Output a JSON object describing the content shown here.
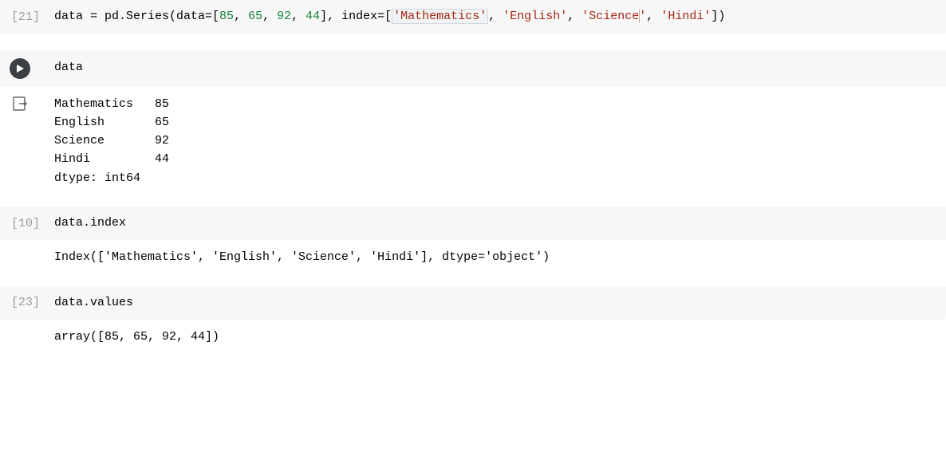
{
  "cells": [
    {
      "exec": "[21]",
      "code": {
        "prefix": "data = pd.Series(data=[",
        "nums": [
          "85",
          "65",
          "92",
          "44"
        ],
        "mid": "], index=[",
        "strs_first": "'Mathematics'",
        "strs_rest": [
          "'English'",
          "'Science'",
          "'Hindi'"
        ],
        "suffix": "])"
      }
    },
    {
      "exec_run": true,
      "code_plain": "data",
      "output_series": {
        "rows": [
          [
            "Mathematics",
            "85"
          ],
          [
            "English",
            "65"
          ],
          [
            "Science",
            "92"
          ],
          [
            "Hindi",
            "44"
          ]
        ],
        "dtype": "dtype: int64"
      }
    },
    {
      "exec": "[10]",
      "code_plain": "data.index",
      "output_plain": "Index(['Mathematics', 'English', 'Science', 'Hindi'], dtype='object')"
    },
    {
      "exec": "[23]",
      "code_plain": "data.values",
      "output_plain": "array([85, 65, 92, 44])"
    }
  ]
}
